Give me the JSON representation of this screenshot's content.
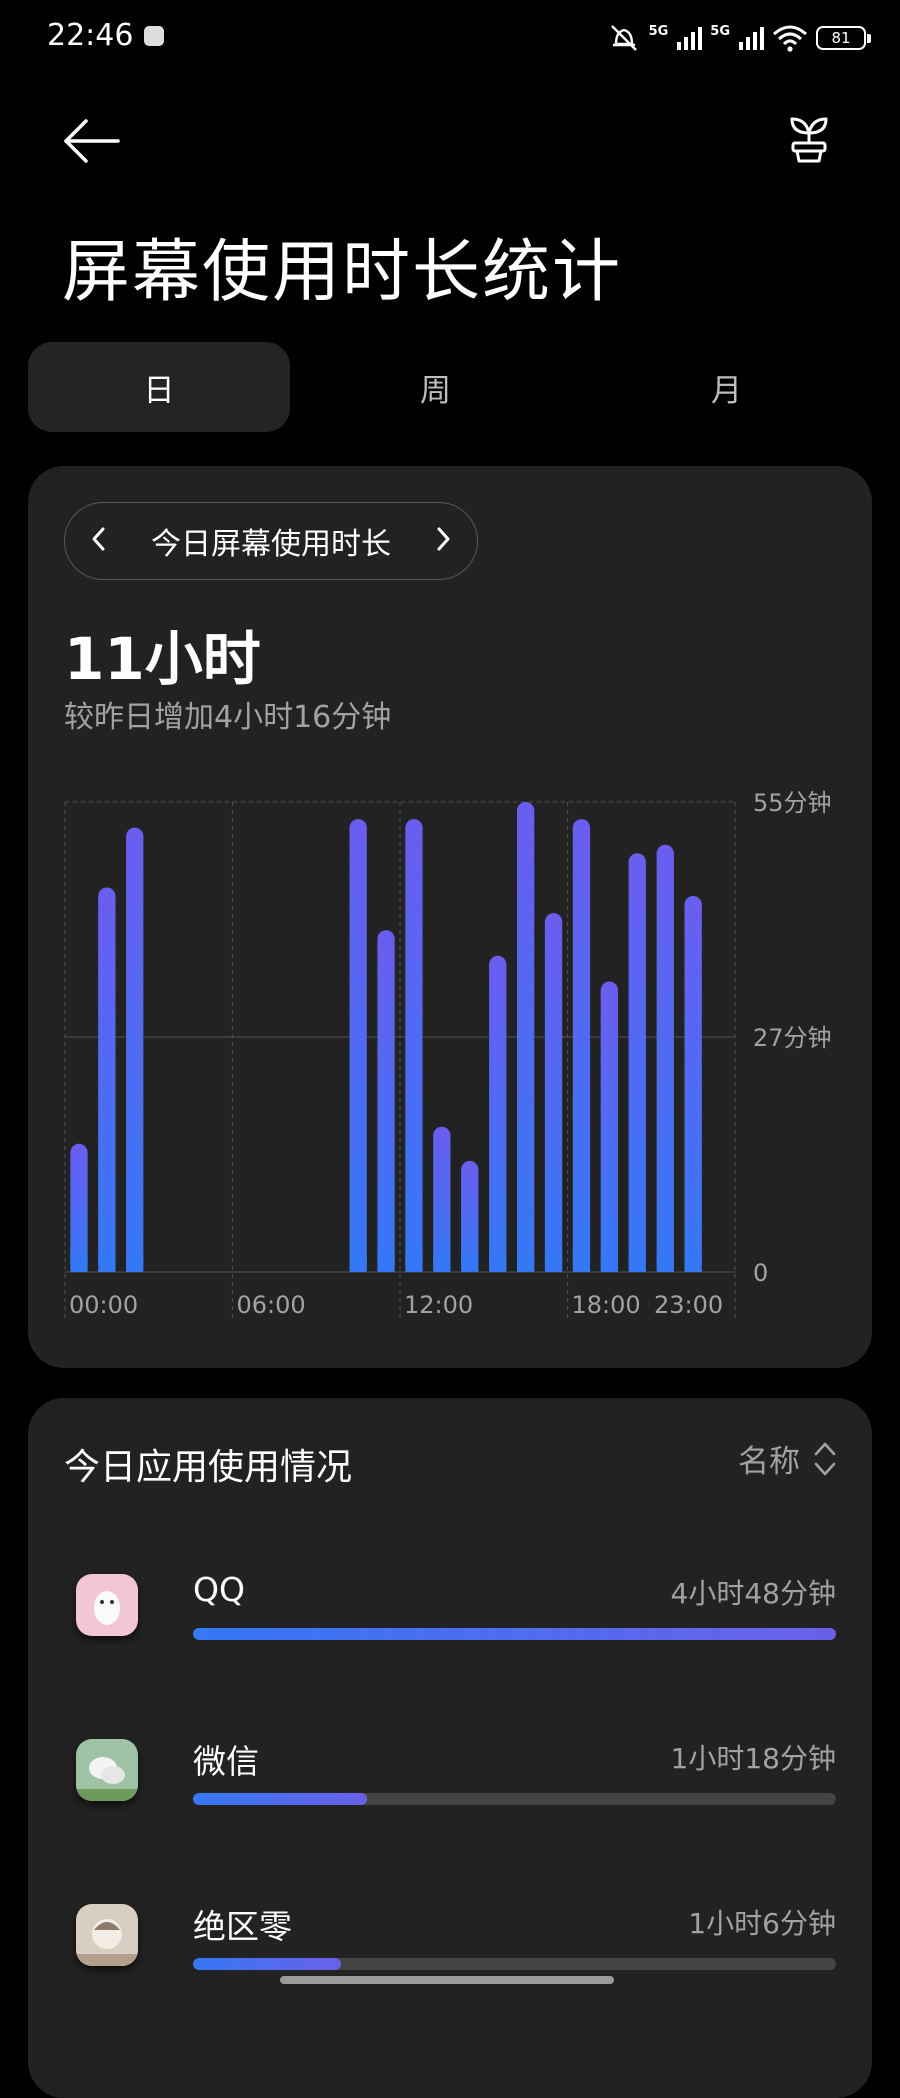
{
  "status_bar": {
    "time": "22:46",
    "network_1": "5G",
    "network_2": "5G",
    "battery": "81"
  },
  "header": {
    "title": "屏幕使用时长统计"
  },
  "tabs": [
    {
      "label": "日",
      "active": true
    },
    {
      "label": "周",
      "active": false
    },
    {
      "label": "月",
      "active": false
    }
  ],
  "summary": {
    "period_label": "今日屏幕使用时长",
    "total": "11小时",
    "comparison": "较昨日增加4小时16分钟"
  },
  "chart_data": {
    "type": "bar",
    "x_tick_labels": [
      "00:00",
      "06:00",
      "12:00",
      "18:00",
      "23:00"
    ],
    "y_tick_labels": [
      "55分钟",
      "27分钟",
      "0"
    ],
    "ylim": [
      0,
      55
    ],
    "categories": [
      "0",
      "1",
      "2",
      "3",
      "4",
      "5",
      "6",
      "7",
      "8",
      "9",
      "10",
      "11",
      "12",
      "13",
      "14",
      "15",
      "16",
      "17",
      "18",
      "19",
      "20",
      "21",
      "22",
      "23"
    ],
    "values": [
      15,
      45,
      52,
      0,
      0,
      0,
      0,
      0,
      0,
      0,
      53,
      40,
      53,
      17,
      13,
      37,
      55,
      42,
      53,
      34,
      49,
      50,
      44,
      0
    ],
    "bar_color_top": "#6a5df0",
    "bar_color_bottom": "#3478f6",
    "grid": true
  },
  "apps_section": {
    "title": "今日应用使用情况",
    "sort_label": "名称",
    "items": [
      {
        "name": "QQ",
        "time": "4小时48分钟",
        "fraction": 1.0
      },
      {
        "name": "微信",
        "time": "1小时18分钟",
        "fraction": 0.27
      },
      {
        "name": "绝区零",
        "time": "1小时6分钟",
        "fraction": 0.23
      }
    ]
  },
  "icons": {
    "back": "arrow-left-icon",
    "plant": "sprout-icon",
    "prev": "chevron-left-icon",
    "next": "chevron-right-icon",
    "sort": "sort-up-down-icon"
  },
  "colors": {
    "background": "#000000",
    "card": "#222222",
    "accent": "#3578f5",
    "accent_end": "#6a60ea"
  }
}
